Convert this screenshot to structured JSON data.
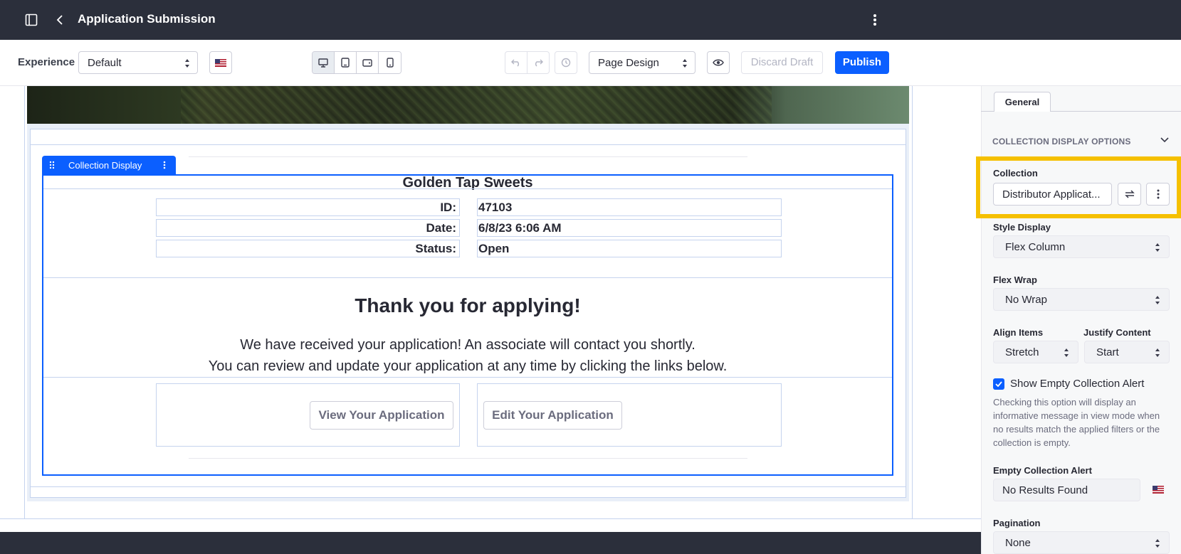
{
  "header": {
    "title": "Application Submission"
  },
  "toolbar": {
    "experience_label": "Experience",
    "experience_value": "Default",
    "page_mode_value": "Page Design",
    "discard_label": "Discard Draft",
    "publish_label": "Publish"
  },
  "canvas": {
    "collection_tab_label": "Collection Display",
    "company": "Golden Tap Sweets",
    "rows": [
      {
        "label": "ID:",
        "value": "47103"
      },
      {
        "label": "Date:",
        "value": "6/8/23 6:06 AM"
      },
      {
        "label": "Status:",
        "value": "Open"
      }
    ],
    "thanks": "Thank you for applying!",
    "message_line1": "We have received your application! An associate will contact you shortly.",
    "message_line2": "You can review and update your application at any time by clicking the links below.",
    "view_button": "View Your Application",
    "edit_button": "Edit Your Application"
  },
  "sidebar": {
    "tab_label": "General",
    "section_title": "COLLECTION DISPLAY OPTIONS",
    "collection_label": "Collection",
    "collection_value": "Distributor Applicat...",
    "style_display_label": "Style Display",
    "style_display_value": "Flex Column",
    "flex_wrap_label": "Flex Wrap",
    "flex_wrap_value": "No Wrap",
    "align_items_label": "Align Items",
    "align_items_value": "Stretch",
    "justify_content_label": "Justify Content",
    "justify_content_value": "Start",
    "show_empty_label": "Show Empty Collection Alert",
    "show_empty_checked": true,
    "show_empty_help": "Checking this option will display an informative message in view mode when no results match the applied filters or the collection is empty.",
    "empty_alert_label": "Empty Collection Alert",
    "empty_alert_value": "No Results Found",
    "pagination_label": "Pagination",
    "pagination_value": "None"
  },
  "colors": {
    "header_bg": "#2b2f3b",
    "primary": "#0b5fff",
    "highlight": "#f5c000"
  }
}
